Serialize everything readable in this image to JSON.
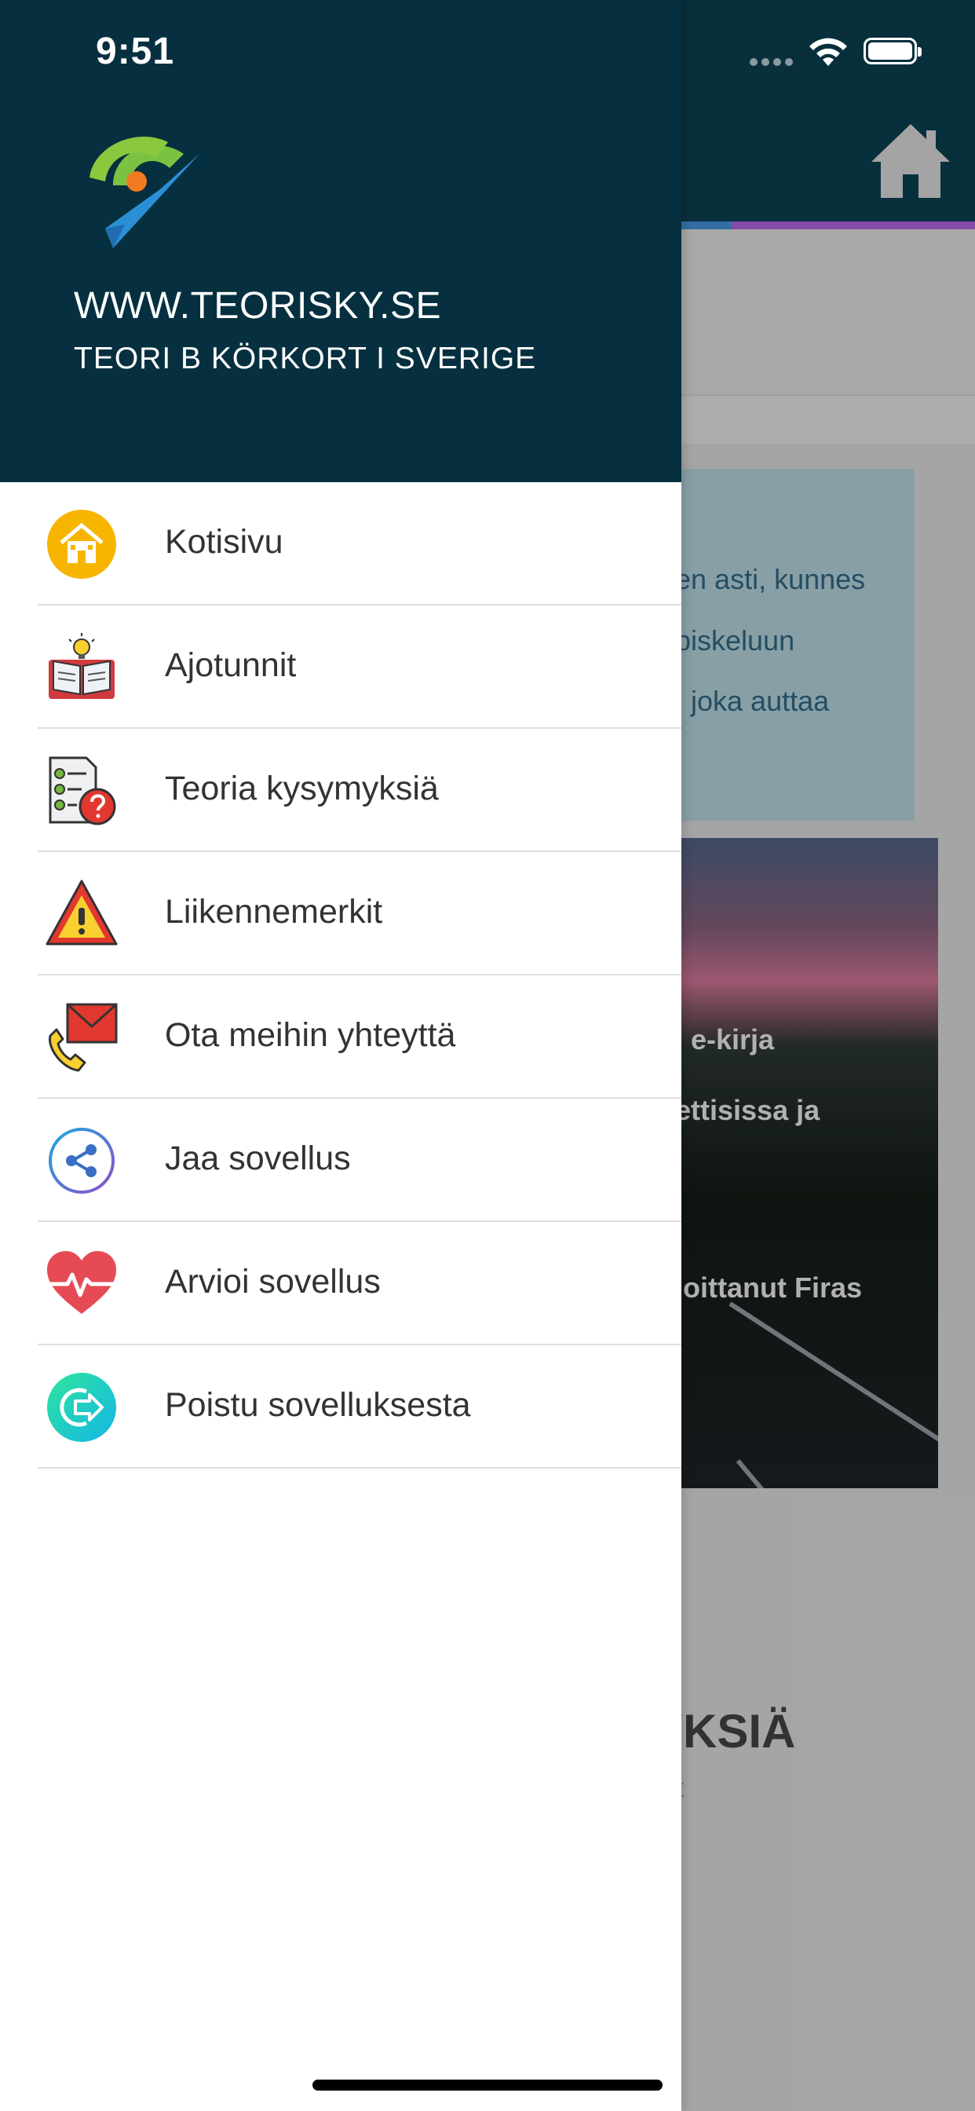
{
  "status_bar": {
    "time": "9:51"
  },
  "drawer": {
    "site_url": "WWW.TEORISKY.SE",
    "site_subtitle": "TEORI B KÖRKORT I SVERIGE",
    "menu": [
      {
        "label": "Kotisivu",
        "icon": "home-icon"
      },
      {
        "label": "Ajotunnit",
        "icon": "book-lightbulb-icon"
      },
      {
        "label": "Teoria kysymyksiä",
        "icon": "checklist-question-icon"
      },
      {
        "label": "Liikennemerkit",
        "icon": "warning-sign-icon"
      },
      {
        "label": "Ota meihin yhteyttä",
        "icon": "phone-mail-icon"
      },
      {
        "label": "Jaa sovellus",
        "icon": "share-icon"
      },
      {
        "label": "Arvioi sovellus",
        "icon": "heart-pulse-icon"
      },
      {
        "label": "Poistu sovelluksesta",
        "icon": "exit-icon"
      }
    ]
  },
  "background": {
    "stripe_colors": [
      "#e5b100",
      "#2aa18a",
      "#3f87c9",
      "#a45ccf"
    ],
    "blue_card_lines": [
      "en asti, kunnes",
      "piskeluun",
      ", joka auttaa"
    ],
    "photo_lines": [
      "i e-kirja",
      "ettisissa ja",
      "joittanut Firas"
    ],
    "section_heading": "YKSIÄ",
    "section_sub": "t"
  }
}
